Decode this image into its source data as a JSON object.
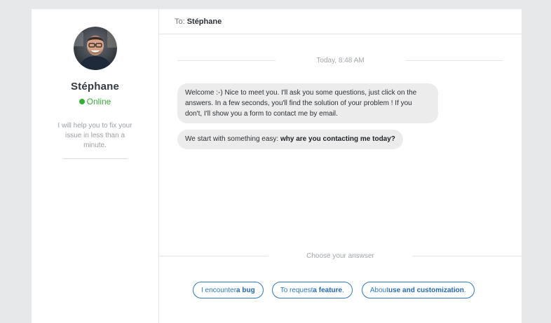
{
  "agent": {
    "name": "Stéphane",
    "status": "Online",
    "tagline": "I will help you to fix your issue in less than a minute."
  },
  "header": {
    "to_label": "To:",
    "recipient": "Stéphane"
  },
  "conversation": {
    "day_label": "Today, 8:48 AM",
    "messages": [
      {
        "text": "Welcome :-) Nice to meet you. I'll ask you some questions, just click on the answers. In a few seconds, you'll find the solution of your problem ! If you don't, I'll show you a form to contact me by email."
      },
      {
        "text_prefix": "We start with something easy: ",
        "text_bold": "why are you contacting me today?"
      }
    ]
  },
  "answers": {
    "prompt": "Choose your answser",
    "options": [
      {
        "prefix": "I encounter ",
        "bold": "a bug",
        "suffix": ""
      },
      {
        "prefix": "To request ",
        "bold": "a feature",
        "suffix": "."
      },
      {
        "prefix": "About ",
        "bold": "use and customization",
        "suffix": "."
      }
    ]
  },
  "colors": {
    "accent": "#2b78c2",
    "online": "#33b033",
    "bubble": "#ececec",
    "background": "#e6e7e9"
  }
}
